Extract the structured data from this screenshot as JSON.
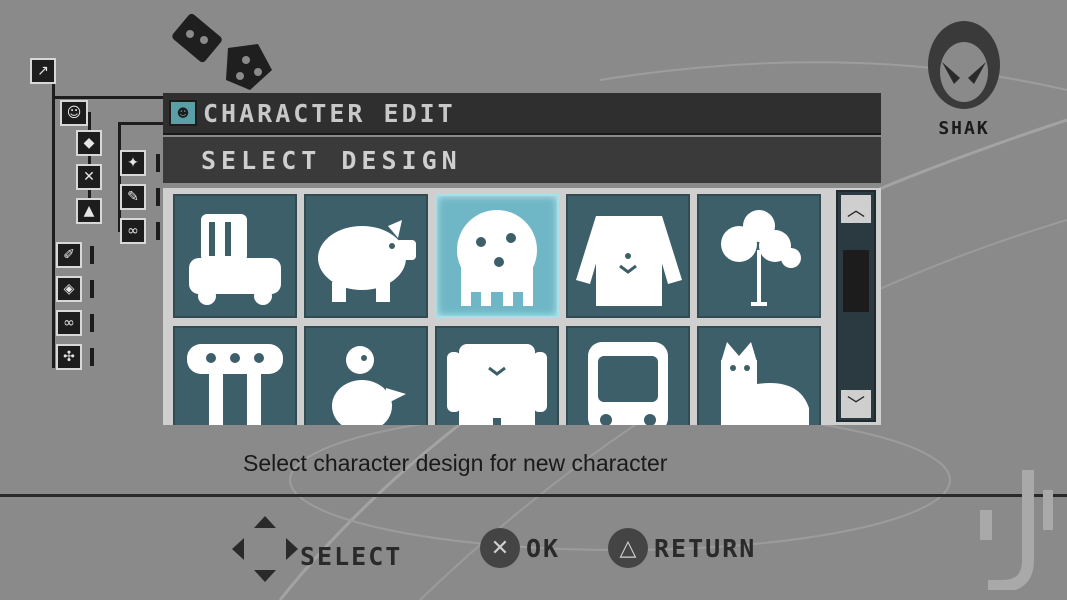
{
  "header": {
    "title": "CHARACTER EDIT",
    "subtitle": "SELECT DESIGN"
  },
  "profile": {
    "name": "SHAK",
    "icon": "alien-head-icon"
  },
  "designs": [
    {
      "name": "truck",
      "icon": "truck-icon",
      "selected": false
    },
    {
      "name": "pig",
      "icon": "pig-icon",
      "selected": false
    },
    {
      "name": "ghost",
      "icon": "ghost-icon",
      "selected": true
    },
    {
      "name": "dog",
      "icon": "dog-icon",
      "selected": false
    },
    {
      "name": "tree",
      "icon": "tree-icon",
      "selected": false
    },
    {
      "name": "table-creature",
      "icon": "table-creature-icon",
      "selected": false
    },
    {
      "name": "duck",
      "icon": "duck-icon",
      "selected": false
    },
    {
      "name": "monster",
      "icon": "monster-icon",
      "selected": false
    },
    {
      "name": "bus",
      "icon": "bus-icon",
      "selected": false
    },
    {
      "name": "cat",
      "icon": "cat-icon",
      "selected": false
    }
  ],
  "hint": "Select character design for new character",
  "footer": {
    "select_label": "SELECT",
    "ok_label": "OK",
    "return_label": "RETURN",
    "ok_glyph": "✕",
    "return_glyph": "△"
  },
  "colors": {
    "accent": "#6fb7c6",
    "cell": "#3d5f6a",
    "background": "#8a8a8a"
  }
}
